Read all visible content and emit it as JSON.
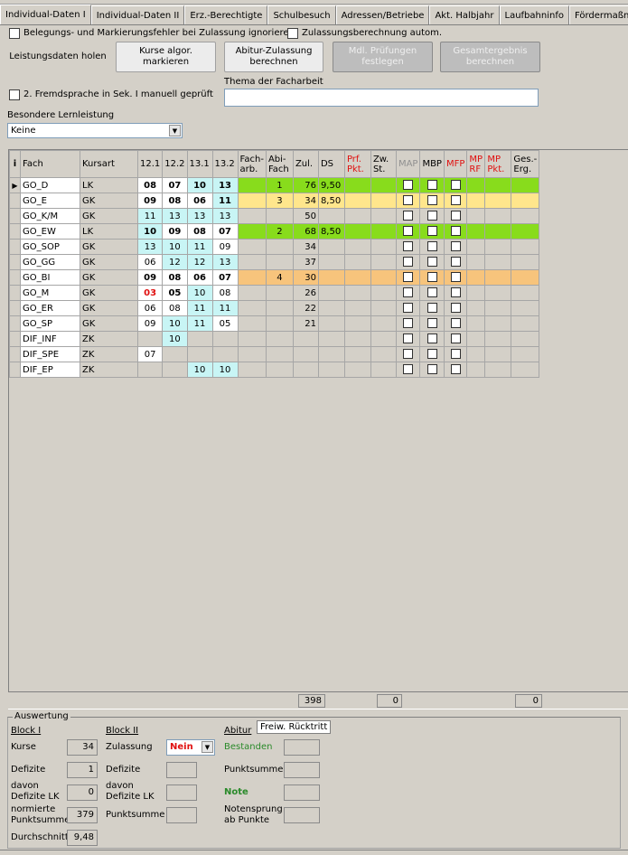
{
  "tabs": [
    "Individual-Daten I",
    "Individual-Daten II",
    "Erz.-Berechtigte",
    "Schulbesuch",
    "Adressen/Betriebe",
    "Akt. Halbjahr",
    "Laufbahninfo",
    "Förderma&szlig;nahm"
  ],
  "options": {
    "ignore_errors_label": "Belegungs- und Markierungsfehler bei Zulassung ignorieren",
    "auto_calc_label": "Zulassungsberechnung autom.",
    "second_lang_label": "2. Fremdsprache in Sek. I manuell geprüft"
  },
  "buttons": {
    "fetch": "Leistungsdaten holen",
    "mark_line1": "Kurse algor.",
    "mark_line2": "markieren",
    "admission_line1": "Abitur-Zulassung",
    "admission_line2": "berechnen",
    "oral_line1": "Mdl. Prüfungen",
    "oral_line2": "festlegen",
    "total_line1": "Gesamtergebnis",
    "total_line2": "berechnen"
  },
  "facharbeit": {
    "label": "Thema der Facharbeit",
    "value": ""
  },
  "special": {
    "label": "Besondere Lernleistung",
    "value": "Keine"
  },
  "grid": {
    "headers": [
      "i",
      "Fach",
      "Kursart",
      "12.1",
      "12.2",
      "13.1",
      "13.2",
      "Fach-arb.",
      "Abi-Fach",
      "Zul.",
      "DS",
      "Prf. Pkt.",
      "Zw. St.",
      "MAP",
      "MBP",
      "MFP",
      "MP RF",
      "MP Pkt.",
      "Ges.-Erg."
    ],
    "header_top": [
      "",
      "",
      "",
      "",
      "",
      "",
      "",
      "Fach-",
      "Abi-",
      "",
      "",
      "Prf.",
      "Zw.",
      "",
      "",
      "",
      "MP",
      "MP",
      "Ges.-"
    ],
    "header_bot": [
      "",
      "",
      "",
      "",
      "",
      "",
      "",
      "arb.",
      "Fach",
      "",
      "",
      "Pkt.",
      "St.",
      "",
      "",
      "",
      "RF",
      "Pkt.",
      "Erg."
    ],
    "rows": [
      {
        "fach": "GO_D",
        "art": "LK",
        "g": [
          "08",
          "07",
          "10",
          "13"
        ],
        "abi": "1",
        "zul": "76",
        "ds": "9,50",
        "color": "green",
        "cur": true
      },
      {
        "fach": "GO_E",
        "art": "GK",
        "g": [
          "09",
          "08",
          "06",
          "11"
        ],
        "abi": "3",
        "zul": "34",
        "ds": "8,50",
        "color": "yellow"
      },
      {
        "fach": "GO_K/M",
        "art": "GK",
        "g": [
          "11",
          "13",
          "13",
          "13"
        ],
        "abi": "",
        "zul": "50",
        "ds": "",
        "color": ""
      },
      {
        "fach": "GO_EW",
        "art": "LK",
        "g": [
          "10",
          "09",
          "08",
          "07"
        ],
        "abi": "2",
        "zul": "68",
        "ds": "8,50",
        "color": "green"
      },
      {
        "fach": "GO_SOP",
        "art": "GK",
        "g": [
          "13",
          "10",
          "11",
          "09"
        ],
        "abi": "",
        "zul": "34",
        "ds": "",
        "color": ""
      },
      {
        "fach": "GO_GG",
        "art": "GK",
        "g": [
          "06",
          "12",
          "12",
          "13"
        ],
        "abi": "",
        "zul": "37",
        "ds": "",
        "color": ""
      },
      {
        "fach": "GO_BI",
        "art": "GK",
        "g": [
          "09",
          "08",
          "06",
          "07"
        ],
        "abi": "4",
        "zul": "30",
        "ds": "",
        "color": "orange"
      },
      {
        "fach": "GO_M",
        "art": "GK",
        "g": [
          "03",
          "05",
          "10",
          "08"
        ],
        "abi": "",
        "zul": "26",
        "ds": "",
        "color": ""
      },
      {
        "fach": "GO_ER",
        "art": "GK",
        "g": [
          "06",
          "08",
          "11",
          "11"
        ],
        "abi": "",
        "zul": "22",
        "ds": "",
        "color": ""
      },
      {
        "fach": "GO_SP",
        "art": "GK",
        "g": [
          "09",
          "10",
          "11",
          "05"
        ],
        "abi": "",
        "zul": "21",
        "ds": "",
        "color": ""
      },
      {
        "fach": "DIF_INF",
        "art": "ZK",
        "g": [
          "",
          "10",
          "",
          ""
        ],
        "abi": "",
        "zul": "",
        "ds": "",
        "color": ""
      },
      {
        "fach": "DIF_SPE",
        "art": "ZK",
        "g": [
          "07",
          "",
          "",
          ""
        ],
        "abi": "",
        "zul": "",
        "ds": "",
        "color": ""
      },
      {
        "fach": "DIF_EP",
        "art": "ZK",
        "g": [
          "",
          "",
          "10",
          "10"
        ],
        "abi": "",
        "zul": "",
        "ds": "",
        "color": ""
      }
    ]
  },
  "sums": {
    "zul": "398",
    "zw": "0",
    "ges": "0"
  },
  "auswertung": {
    "title": "Auswertung",
    "block1": {
      "title": "Block I",
      "kurse_label": "Kurse",
      "kurse": "34",
      "defizite_label": "Defizite",
      "defizite": "1",
      "davon_label1": "davon",
      "davon_label2": "Defizite LK",
      "davon": "0",
      "norm_label1": "normierte",
      "norm_label2": "Punktsumme",
      "norm": "379",
      "avg_label": "Durchschnitt",
      "avg": "9,48"
    },
    "block2": {
      "title": "Block II",
      "zul_label": "Zulassung",
      "zul": "Nein",
      "defizite_label": "Defizite",
      "davon_label1": "davon",
      "davon_label2": "Defizite LK",
      "punkt_label": "Punktsumme"
    },
    "abitur": {
      "title": "Abitur",
      "tooltip": "Freiw. Rücktritt",
      "bestanden_label": "Bestanden",
      "punkt_label": "Punktsumme",
      "note_label": "Note",
      "sprung_label1": "Notensprung",
      "sprung_label2": "ab Punkte"
    }
  }
}
